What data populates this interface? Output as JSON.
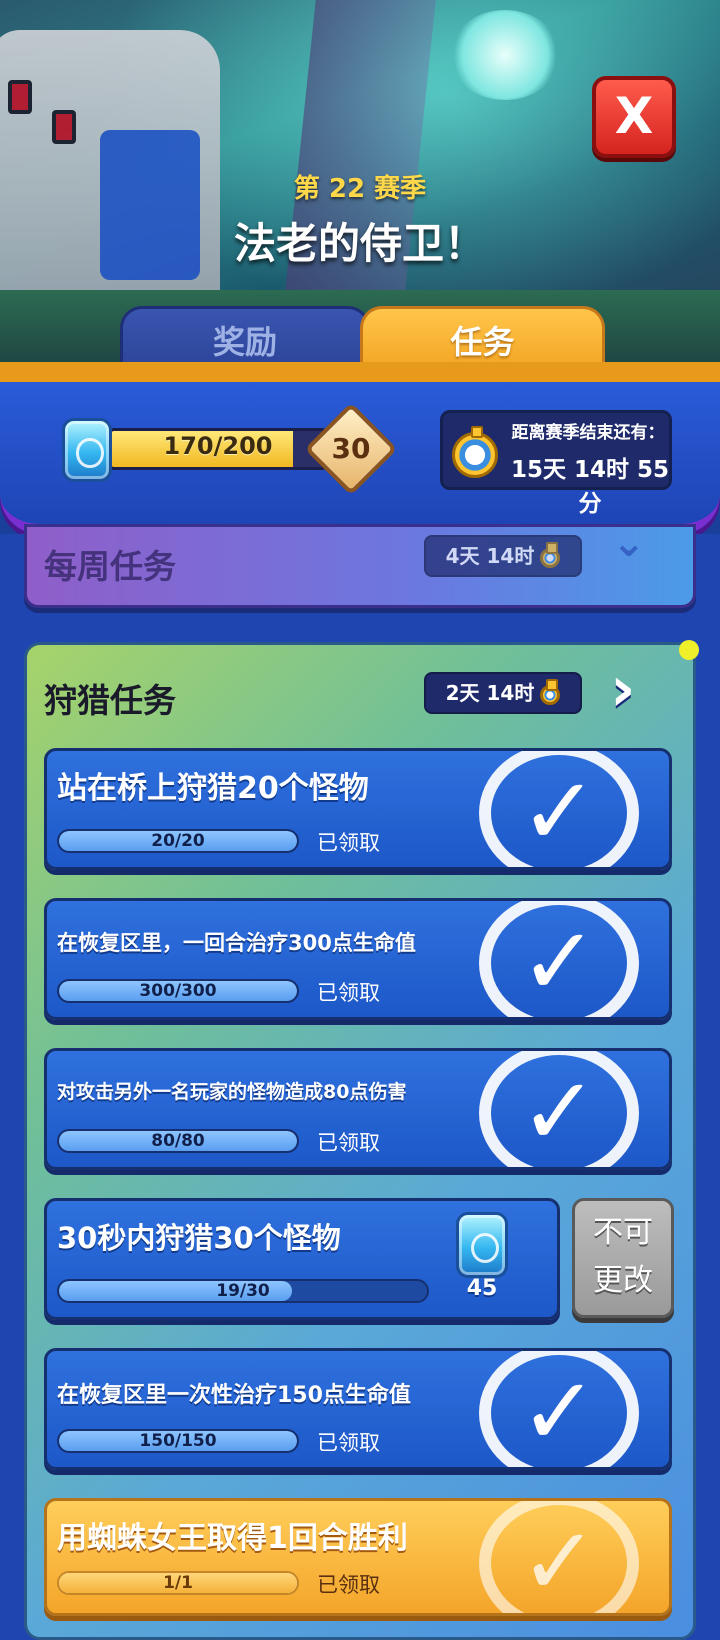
{
  "banner": {
    "season_label": "第 22 赛季",
    "season_title": "法老的侍卫！"
  },
  "close_button": {
    "label": "X"
  },
  "tabs": [
    {
      "label": "奖励",
      "active": false
    },
    {
      "label": "任务",
      "active": true
    }
  ],
  "season_progress": {
    "xp_text": "170/200",
    "xp_fraction": 0.85,
    "level": "30",
    "timer_label": "距离赛季结束还有：",
    "timer_value": "15天 14时 55分"
  },
  "weekly": {
    "title": "每周任务",
    "timer": "4天 14时"
  },
  "hunt": {
    "title": "狩猎任务",
    "timer": "2天 14时"
  },
  "tasks": [
    {
      "title": "站在桥上狩猎20个怪物",
      "progress": "20/20",
      "fraction": 1.0,
      "status": "已领取"
    },
    {
      "title": "在恢复区里，一回合治疗300点生命值",
      "progress": "300/300",
      "fraction": 1.0,
      "status": "已领取"
    },
    {
      "title": "对攻击另外一名玩家的怪物造成80点伤害",
      "progress": "80/80",
      "fraction": 1.0,
      "status": "已领取"
    },
    {
      "title": "30秒内狩猎30个怪物",
      "progress": "19/30",
      "fraction": 0.633,
      "reward": "45",
      "button": "不可\n更改"
    },
    {
      "title": "在恢复区里一次性治疗150点生命值",
      "progress": "150/150",
      "fraction": 1.0,
      "status": "已领取"
    },
    {
      "title": "用蜘蛛女王取得1回合胜利",
      "progress": "1/1",
      "fraction": 1.0,
      "status": "已领取"
    }
  ],
  "icons": {
    "close": "close-icon",
    "gem": "gem-icon",
    "stopwatch": "stopwatch-icon",
    "check": "check-icon",
    "chevron": "chevron-right-icon"
  },
  "colors": {
    "tab_active": "#f3a322",
    "task_blue": "#2f71de",
    "task_gold": "#ffce5a",
    "xp_fill": "#f1b820"
  }
}
